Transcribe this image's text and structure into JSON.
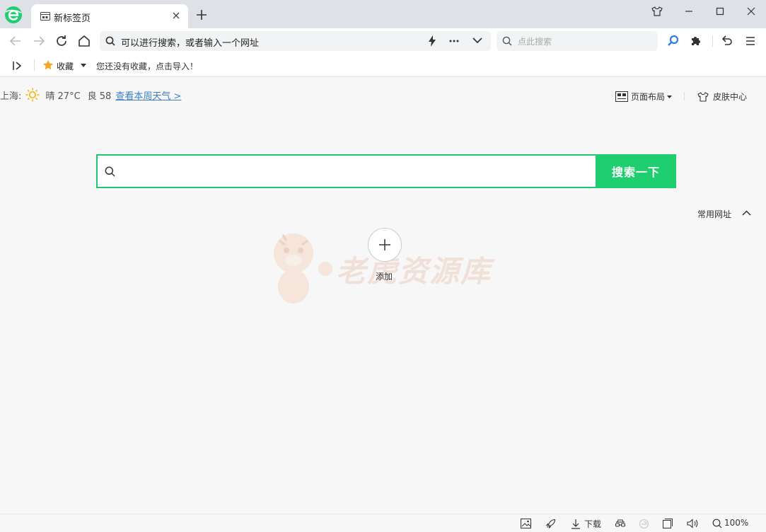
{
  "tab": {
    "title": "新标签页"
  },
  "address": {
    "placeholder": "可以进行搜索，或者输入一个网址"
  },
  "search_box": {
    "placeholder": "点此搜索"
  },
  "bookmarks": {
    "label": "收藏",
    "hint": "您还没有收藏，点击导入！"
  },
  "weather": {
    "city": "上海:",
    "condition": "晴 27°C",
    "aqi": "良 58",
    "link": "查看本周天气 >"
  },
  "top_actions": {
    "layout": "页面布局",
    "skin": "皮肤中心"
  },
  "main_search": {
    "button": "搜索一下"
  },
  "common_sites": {
    "label": "常用网址",
    "add_label": "添加"
  },
  "watermark": {
    "text": "老虎资源库"
  },
  "status": {
    "download": "下载",
    "zoom": "100%"
  },
  "colors": {
    "accent": "#1fcf6f",
    "link": "#3b7fc4"
  }
}
